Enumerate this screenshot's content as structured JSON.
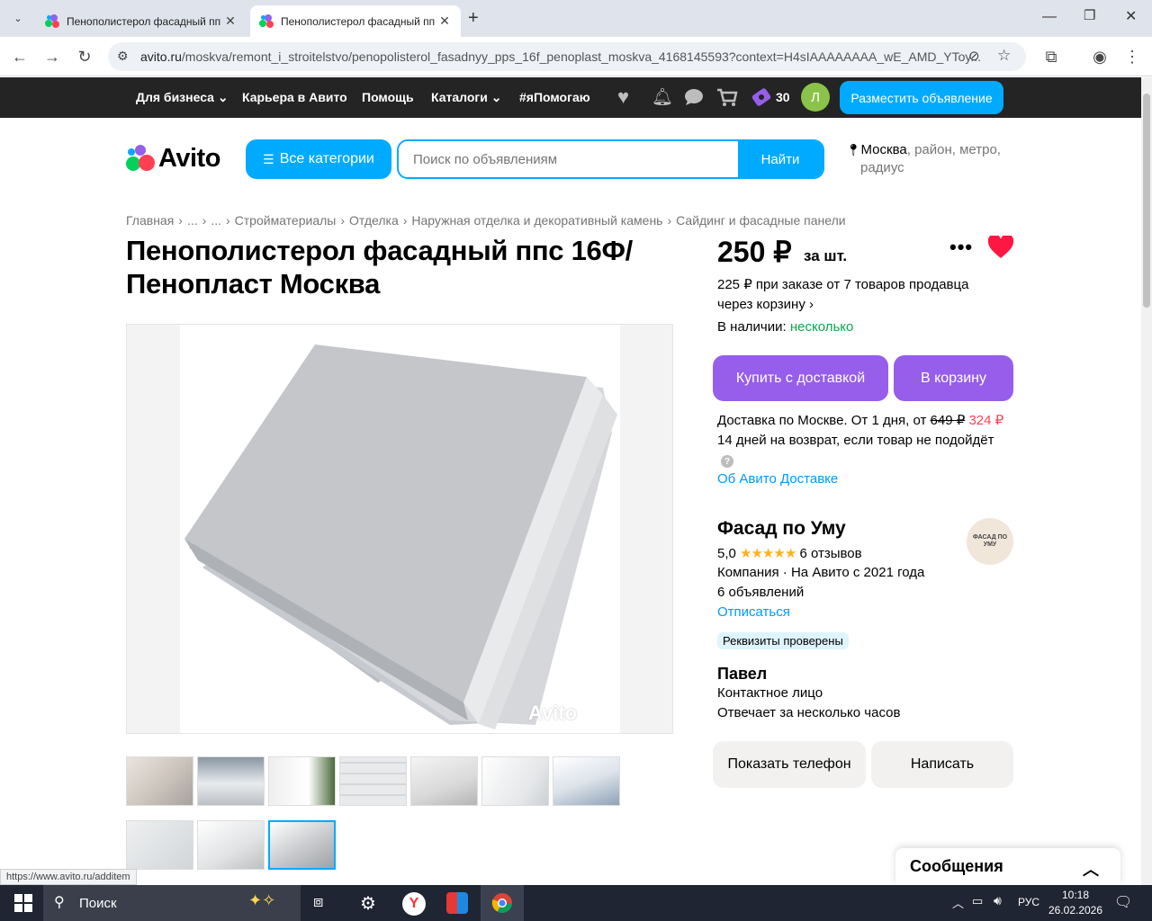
{
  "browser": {
    "tabs": [
      {
        "title": "Пенополистерол фасадный пп",
        "active": false
      },
      {
        "title": "Пенополистерол фасадный пп",
        "active": true
      }
    ],
    "url_host": "avito.ru",
    "url_rest": "/moskva/remont_i_stroitelstvo/penopolisterol_fasadnyy_pps_16f_penoplast_moskva_4168145593?context=H4sIAAAAAAAA_wE_AMD_YToy..."
  },
  "topbar": {
    "links": [
      "Для бизнеса",
      "Карьера в Авито",
      "Помощь",
      "Каталоги",
      "#яПомогаю"
    ],
    "bonus_count": "30",
    "avatar_letter": "Л",
    "post_button": "Разместить объявление"
  },
  "header": {
    "logo": "Avito",
    "categories_button": "Все категории",
    "search_placeholder": "Поиск по объявлениям",
    "search_button": "Найти",
    "location_city": "Москва",
    "location_rest1": ", район, метро,",
    "location_rest2": "радиус"
  },
  "breadcrumb": [
    "Главная",
    "...",
    "...",
    "Стройматериалы",
    "Отделка",
    "Наружная отделка и декоративный камень",
    "Сайдинг и фасадные панели"
  ],
  "listing": {
    "title_line1": "Пенополистерол фасадный ппс 16Ф/",
    "title_line2": "Пенопласт Москва",
    "watermark": "Avito"
  },
  "price": {
    "value": "250 ₽",
    "unit": "за шт.",
    "bulk_line1": "225 ₽ при заказе от 7 товаров продавца",
    "bulk_line2": "через корзину",
    "stock_label": "В наличии:",
    "stock_value": "несколько",
    "buy_button": "Купить с доставкой",
    "cart_button": "В корзину",
    "delivery_text": "Доставка по Москве. От 1 дня, от",
    "delivery_old": "649 ₽",
    "delivery_new": "324 ₽",
    "return_text": "14 дней на возврат, если товар не подойдёт",
    "about_delivery": "Об Авито Доставке"
  },
  "seller": {
    "name": "Фасад по Уму",
    "logo_text": "ФАСАД ПО УМУ",
    "rating": "5,0",
    "stars": "★★★★★",
    "reviews": "6 отзывов",
    "type": "Компания · На Авито с 2021 года",
    "ads": "6 объявлений",
    "unsubscribe": "Отписаться",
    "verified": "Реквизиты проверены",
    "contact_name": "Павел",
    "contact_role": "Контактное лицо",
    "response": "Отвечает за несколько часов",
    "phone_button": "Показать телефон",
    "write_button": "Написать"
  },
  "messages": {
    "label": "Сообщения"
  },
  "status_url": "https://www.avito.ru/additem",
  "taskbar": {
    "search": "Поиск",
    "lang": "РУС",
    "time": "10:18",
    "date": "26.02.2026"
  },
  "colors": {
    "accent": "#00aaff",
    "purple": "#965eeb",
    "green": "#02d15c",
    "red": "#ff4053",
    "link": "#0099f7"
  }
}
